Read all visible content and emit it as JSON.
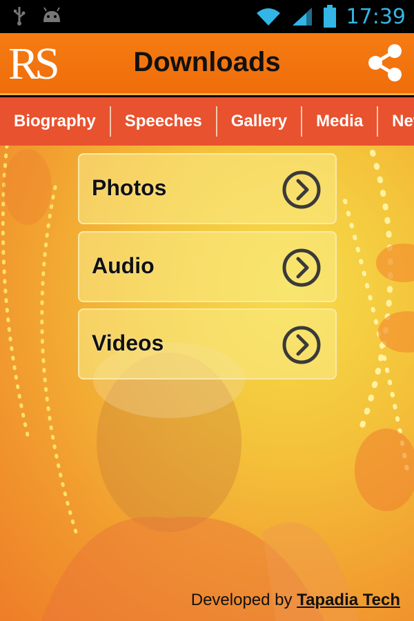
{
  "status_bar": {
    "time": "17:39"
  },
  "header": {
    "logo": "RS",
    "title": "Downloads"
  },
  "tabs": [
    "Biography",
    "Speeches",
    "Gallery",
    "Media",
    "News"
  ],
  "cards": [
    {
      "label": "Photos"
    },
    {
      "label": "Audio"
    },
    {
      "label": "Videos"
    }
  ],
  "footer": {
    "prefix": "Developed by",
    "brand": "Tapadia Tech"
  },
  "colors": {
    "header": "#f57c12",
    "tabs": "#e8522f",
    "status_time": "#33b5e5"
  }
}
